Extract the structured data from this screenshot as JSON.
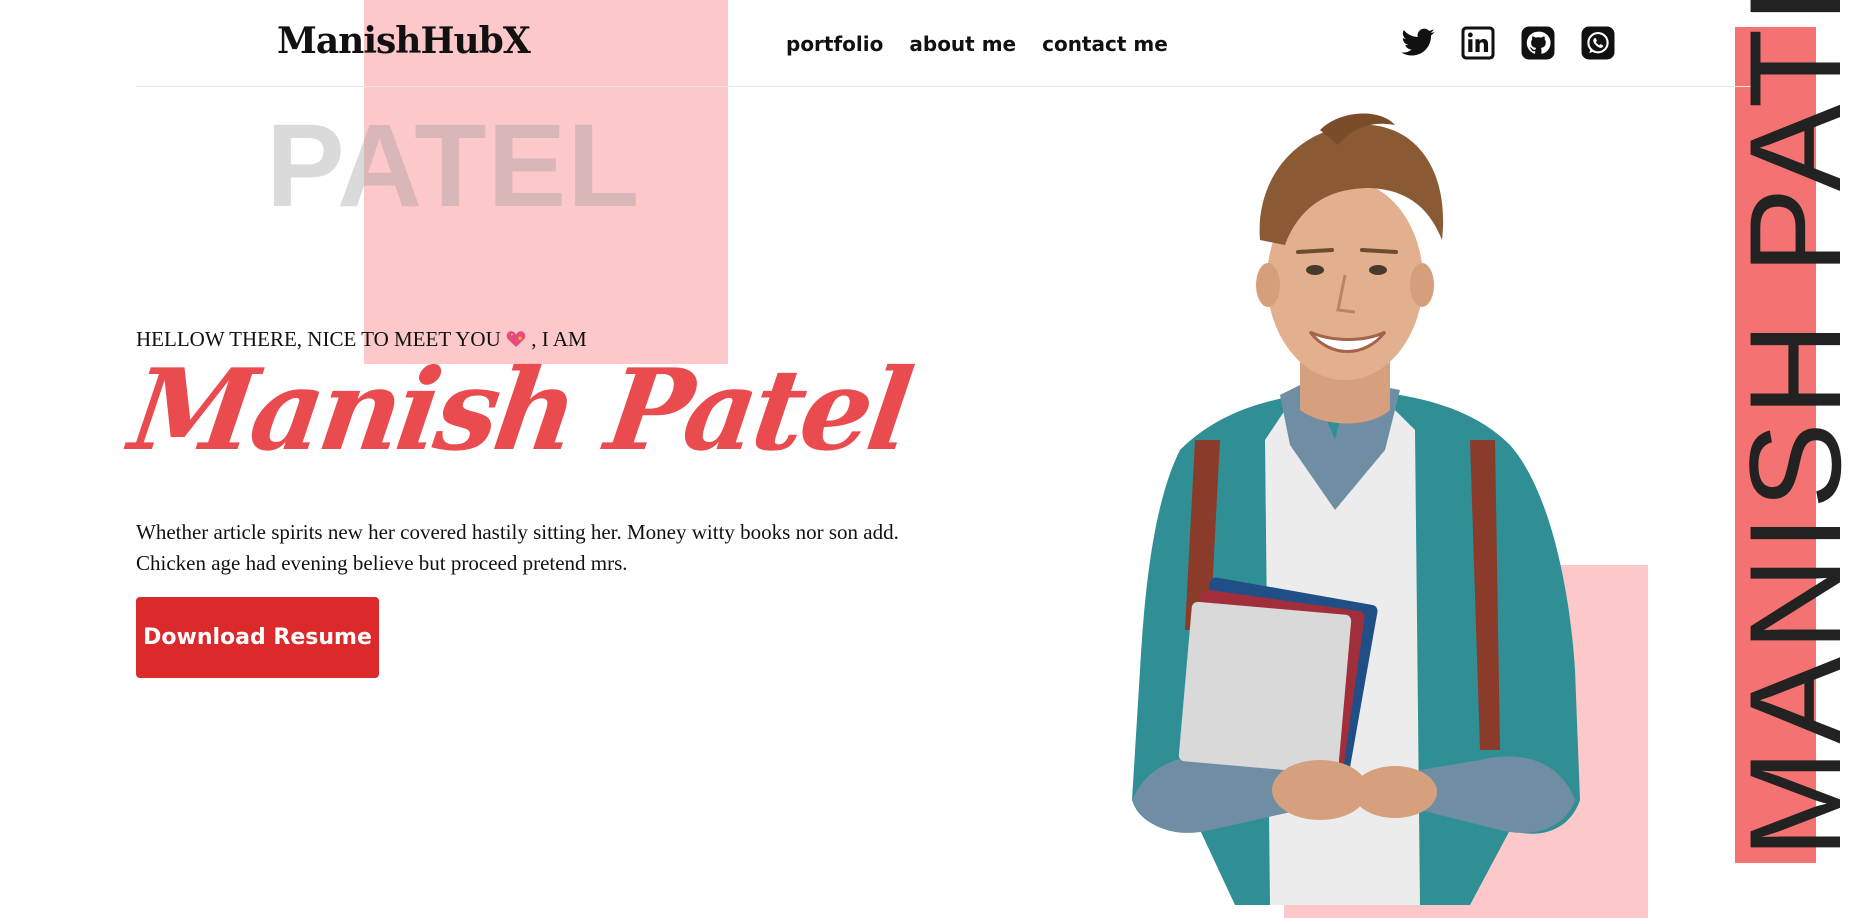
{
  "header": {
    "logo": "ManishHubX",
    "nav": [
      {
        "label": "portfolio"
      },
      {
        "label": "about me"
      },
      {
        "label": "contact me"
      }
    ],
    "socials": [
      {
        "icon": "twitter-icon"
      },
      {
        "icon": "linkedin-icon"
      },
      {
        "icon": "github-icon"
      },
      {
        "icon": "whatsapp-icon"
      }
    ]
  },
  "hero": {
    "ghost_text": "PATEL",
    "greeting_before": "HELLOW THERE, NICE TO MEET YOU",
    "greeting_after": ", I AM",
    "name": "Manish Patel",
    "description_line1": "Whether article spirits new her covered hastily sitting her. Money witty books nor son add.",
    "description_line2": "Chicken age had evening believe but proceed pretend mrs.",
    "cta_label": "Download Resume",
    "vertical_name": "MANISH PATEL"
  },
  "colors": {
    "accent_red": "#dc2a2c",
    "script_red": "#e94b4f",
    "pink_block": "#fdc8c9",
    "strip_red": "#f47272"
  }
}
